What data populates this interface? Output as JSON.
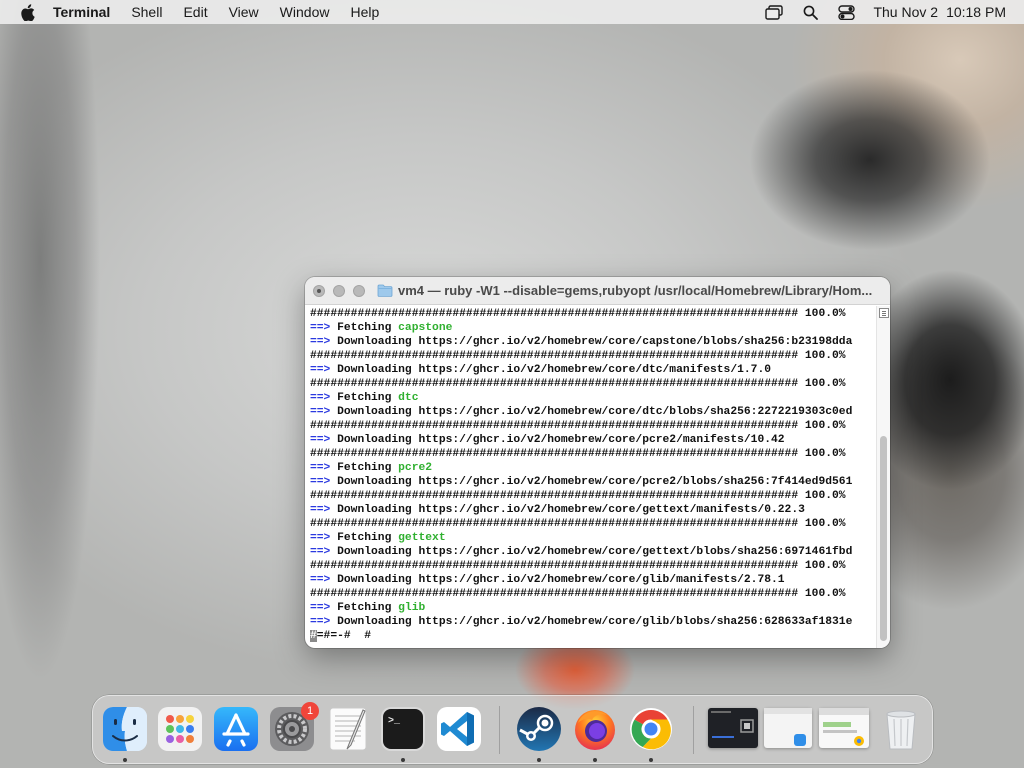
{
  "menubar": {
    "app_name": "Terminal",
    "menus": [
      "Shell",
      "Edit",
      "View",
      "Window",
      "Help"
    ],
    "date": "Thu Nov 2",
    "time": "10:18 PM"
  },
  "terminal": {
    "title": "vm4 — ruby -W1 --disable=gems,rubyopt /usr/local/Homebrew/Library/Hom...",
    "progress_bar": "######################################################################## 100.0%",
    "arrow": "==>",
    "lines": [
      {
        "type": "progress"
      },
      {
        "type": "fetch",
        "text": "Fetching",
        "pkg": "capstone"
      },
      {
        "type": "download",
        "text": "Downloading https://ghcr.io/v2/homebrew/core/capstone/blobs/sha256:b23198dda"
      },
      {
        "type": "progress"
      },
      {
        "type": "download",
        "text": "Downloading https://ghcr.io/v2/homebrew/core/dtc/manifests/1.7.0"
      },
      {
        "type": "progress"
      },
      {
        "type": "fetch",
        "text": "Fetching",
        "pkg": "dtc"
      },
      {
        "type": "download",
        "text": "Downloading https://ghcr.io/v2/homebrew/core/dtc/blobs/sha256:2272219303c0ed"
      },
      {
        "type": "progress"
      },
      {
        "type": "download",
        "text": "Downloading https://ghcr.io/v2/homebrew/core/pcre2/manifests/10.42"
      },
      {
        "type": "progress"
      },
      {
        "type": "fetch",
        "text": "Fetching",
        "pkg": "pcre2"
      },
      {
        "type": "download",
        "text": "Downloading https://ghcr.io/v2/homebrew/core/pcre2/blobs/sha256:7f414ed9d561"
      },
      {
        "type": "progress"
      },
      {
        "type": "download",
        "text": "Downloading https://ghcr.io/v2/homebrew/core/gettext/manifests/0.22.3"
      },
      {
        "type": "progress"
      },
      {
        "type": "fetch",
        "text": "Fetching",
        "pkg": "gettext"
      },
      {
        "type": "download",
        "text": "Downloading https://ghcr.io/v2/homebrew/core/gettext/blobs/sha256:6971461fbd"
      },
      {
        "type": "progress"
      },
      {
        "type": "download",
        "text": "Downloading https://ghcr.io/v2/homebrew/core/glib/manifests/2.78.1"
      },
      {
        "type": "progress"
      },
      {
        "type": "fetch",
        "text": "Fetching",
        "pkg": "glib"
      },
      {
        "type": "download",
        "text": "Downloading https://ghcr.io/v2/homebrew/core/glib/blobs/sha256:628633af1831e"
      },
      {
        "type": "cursor",
        "cursor_char": "#",
        "text": "=#=-#  #"
      }
    ]
  },
  "dock": {
    "items": [
      {
        "name": "finder-icon",
        "running": true
      },
      {
        "name": "launchpad-icon",
        "running": false
      },
      {
        "name": "app-store-icon",
        "running": false
      },
      {
        "name": "system-settings-icon",
        "running": false,
        "badge": "1"
      },
      {
        "name": "textedit-icon",
        "running": false
      },
      {
        "name": "terminal-icon",
        "running": true
      },
      {
        "name": "vscode-icon",
        "running": false
      },
      {
        "name": "steam-icon",
        "running": true
      },
      {
        "name": "firefox-icon",
        "running": true
      },
      {
        "name": "chrome-icon",
        "running": true
      }
    ],
    "terminal_icon_prompt": ">_"
  }
}
